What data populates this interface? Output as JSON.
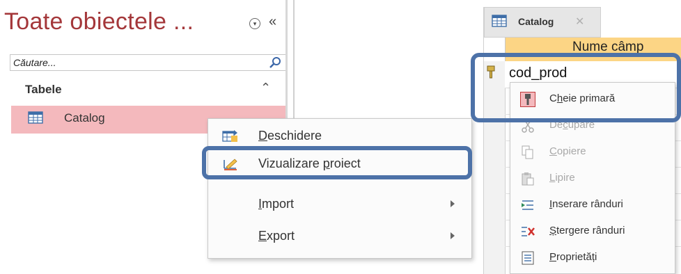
{
  "nav_pane": {
    "title": "Toate obiectele ...",
    "search_placeholder": "Căutare...",
    "group_label": "Tabele",
    "items": [
      {
        "label": "Catalog",
        "icon": "table-icon"
      }
    ]
  },
  "context_menu_object": {
    "items": [
      {
        "label_pre": "",
        "accel": "D",
        "label_post": "eschidere",
        "icon": "open-table-icon"
      },
      {
        "label_pre": "Vizualizare ",
        "accel": "p",
        "label_post": "roiect",
        "icon": "design-view-icon",
        "highlighted": true
      },
      {
        "label_pre": "",
        "accel": "I",
        "label_post": "mport",
        "icon": "",
        "submenu": true
      },
      {
        "label_pre": "",
        "accel": "E",
        "label_post": "xport",
        "icon": "",
        "submenu": true
      }
    ]
  },
  "design_view": {
    "tab_label": "Catalog",
    "column_header": "Nume câmp",
    "field_name": "cod_prod"
  },
  "context_menu_field": {
    "items": [
      {
        "label_pre": "C",
        "accel": "h",
        "label_post": "eie primară",
        "icon": "primary-key-icon",
        "disabled": false
      },
      {
        "label_pre": "De",
        "accel": "c",
        "label_post": "upare",
        "icon": "scissors-icon",
        "disabled": true
      },
      {
        "label_pre": "",
        "accel": "C",
        "label_post": "opiere",
        "icon": "copy-icon",
        "disabled": true
      },
      {
        "label_pre": "",
        "accel": "L",
        "label_post": "ipire",
        "icon": "paste-icon",
        "disabled": true
      },
      {
        "label_pre": "",
        "accel": "I",
        "label_post": "nserare rânduri",
        "icon": "insert-rows-icon",
        "disabled": false
      },
      {
        "label_pre": "",
        "accel": "Ș",
        "label_post": "tergere rânduri",
        "icon": "delete-rows-icon",
        "disabled": false
      },
      {
        "label_pre": "",
        "accel": "P",
        "label_post": "roprietăți",
        "icon": "properties-icon",
        "disabled": false
      }
    ]
  },
  "colors": {
    "accent_title": "#a4373a",
    "selected_item": "#f4b9bd",
    "header_fill": "#fcd585",
    "highlight_outline": "#4d72a8"
  }
}
